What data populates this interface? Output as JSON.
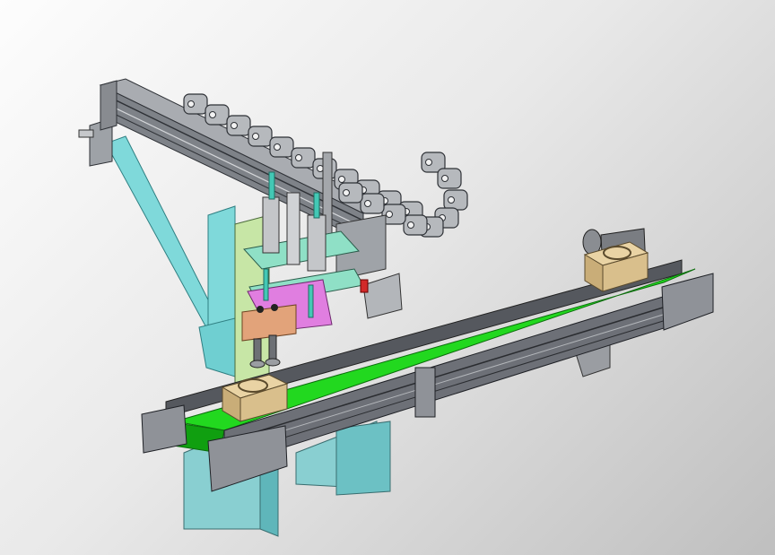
{
  "scene": {
    "kind": "3d-cad-render",
    "components": [
      "cable-carrier-chain",
      "linear-actuator-rail",
      "triangular-support-frame",
      "pneumatic-cylinders",
      "pick-head",
      "belt-conveyor",
      "green-belt",
      "workpiece-blocks",
      "drive-motor",
      "support-legs"
    ]
  },
  "colors": {
    "background_light": "#fdfdfd",
    "background_dark": "#bfbfbf",
    "frame_cyan": "#7fd9da",
    "frame_cyan_dark": "#3fb7bb",
    "rail_gray": "#8d9096",
    "rail_dark": "#4c4f55",
    "belt_green": "#22d81f",
    "belt_green_dark": "#109f10",
    "block_tan": "#d9bf8c",
    "plate_pink": "#e07ee0",
    "plate_orange": "#e2a37a",
    "plate_teal": "#8fe0c6",
    "plate_lightgreen": "#c7e6a6",
    "chain_gray": "#b6b9bd",
    "accent_red": "#d22a2a",
    "rod_teal": "#43c8b5"
  }
}
